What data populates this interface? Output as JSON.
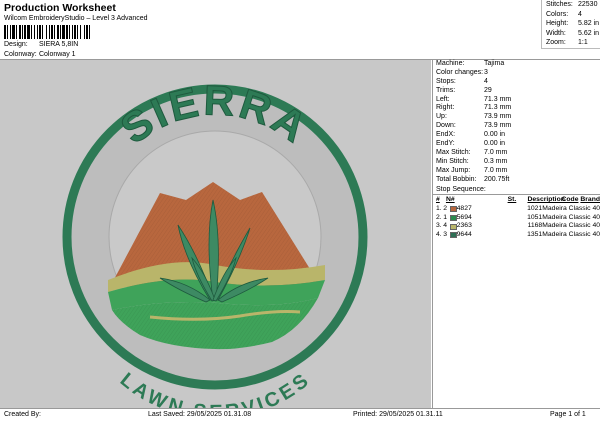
{
  "header": {
    "title": "Production Worksheet",
    "subtitle": "Wilcom EmbroideryStudio – Level 3 Advanced",
    "design_label": "Design:",
    "design_value": "SIERA 5,8IN",
    "colorway_label": "Colonway:",
    "colorway_value": "Colonway 1"
  },
  "stats": [
    {
      "label": "Stitches:",
      "value": "22530"
    },
    {
      "label": "Colors:",
      "value": "4"
    },
    {
      "label": "Height:",
      "value": "5.82 in"
    },
    {
      "label": "Width:",
      "value": "5.62 in"
    },
    {
      "label": "Zoom:",
      "value": "1:1"
    }
  ],
  "machine_info": [
    {
      "label": "Machine:",
      "value": "Tajima"
    },
    {
      "label": "Color changes:",
      "value": "3"
    },
    {
      "label": "Stops:",
      "value": "4"
    },
    {
      "label": "Trims:",
      "value": "29"
    },
    {
      "label": "Left:",
      "value": "71.3 mm"
    },
    {
      "label": "Right:",
      "value": "71.3 mm"
    },
    {
      "label": "Up:",
      "value": "73.9 mm"
    },
    {
      "label": "Down:",
      "value": "73.9 mm"
    },
    {
      "label": "EndX:",
      "value": "0.00 in"
    },
    {
      "label": "EndY:",
      "value": "0.00 in"
    },
    {
      "label": "Max Stitch:",
      "value": "7.0 mm"
    },
    {
      "label": "Min Stitch:",
      "value": "0.3 mm"
    },
    {
      "label": "Max Jump:",
      "value": "7.0 mm"
    },
    {
      "label": "Total Bobbin:",
      "value": "200.75ft"
    }
  ],
  "stop_sequence": {
    "title": "Stop Sequence:",
    "headers": {
      "num": "#",
      "n": "N#",
      "st": "St.",
      "desc": "Description",
      "code": "Code",
      "brand": "Brand"
    },
    "rows": [
      {
        "num": "1.",
        "n": "2",
        "color": "#b8673e",
        "code": "4827",
        "st": "1021",
        "brand": "Madeira Classic 40"
      },
      {
        "num": "2.",
        "n": "1",
        "color": "#2a8a4e",
        "code": "5694",
        "st": "1051",
        "brand": "Madeira Classic 40"
      },
      {
        "num": "3.",
        "n": "4",
        "color": "#b9b56a",
        "code": "2363",
        "st": "1168",
        "brand": "Madeira Classic 40"
      },
      {
        "num": "4.",
        "n": "3",
        "color": "#2e6f55",
        "code": "9644",
        "st": "1351",
        "brand": "Madeira Classic 40"
      }
    ]
  },
  "logo": {
    "top_text": "SIERRA",
    "bottom_text": "LAWN SERVICES"
  },
  "footer": {
    "created_by": "Created By:",
    "last_saved": "Last Saved: 29/05/2025 01.31.08",
    "printed": "Printed: 29/05/2025 01.31.11",
    "page": "Page 1 of 1"
  },
  "colors": {
    "background": "#c8c8c8",
    "ring": "#2d7a55",
    "mountain": "#b8673e",
    "leaf": "#3d8a63",
    "hill_light": "#b9b56a",
    "hill_green": "#3fa35a"
  }
}
